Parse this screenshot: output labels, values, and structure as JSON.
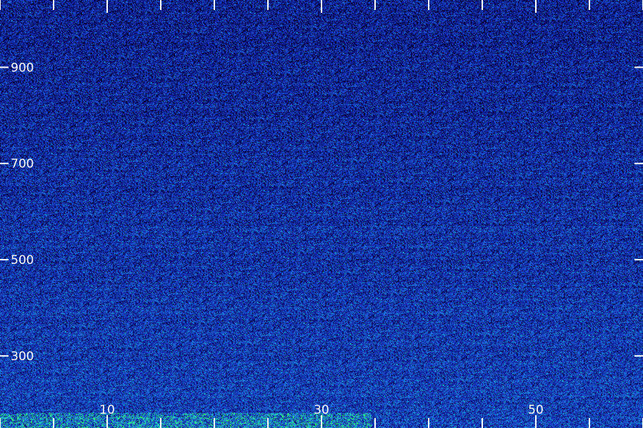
{
  "chart_data": {
    "type": "heatmap",
    "title": "",
    "xlabel": "",
    "ylabel": "",
    "x_tick_labels": [
      "10",
      "30",
      "50"
    ],
    "x_tick_values": [
      10,
      30,
      50
    ],
    "y_tick_labels": [
      "300",
      "500",
      "700",
      "900"
    ],
    "y_tick_values": [
      300,
      500,
      700,
      900
    ],
    "xlim": [
      0,
      60
    ],
    "ylim": [
      150,
      1040
    ],
    "x_minor_tick_values": [
      0,
      5,
      10,
      15,
      20,
      25,
      30,
      35,
      40,
      45,
      50,
      55,
      60
    ],
    "grid": false,
    "colormap": [
      "#000033",
      "#0a1a9a",
      "#1f4fd6",
      "#1e9be0",
      "#1fd8c8",
      "#3dff6a"
    ],
    "background_color": "#00003a",
    "axis_color": "#ffffff"
  }
}
